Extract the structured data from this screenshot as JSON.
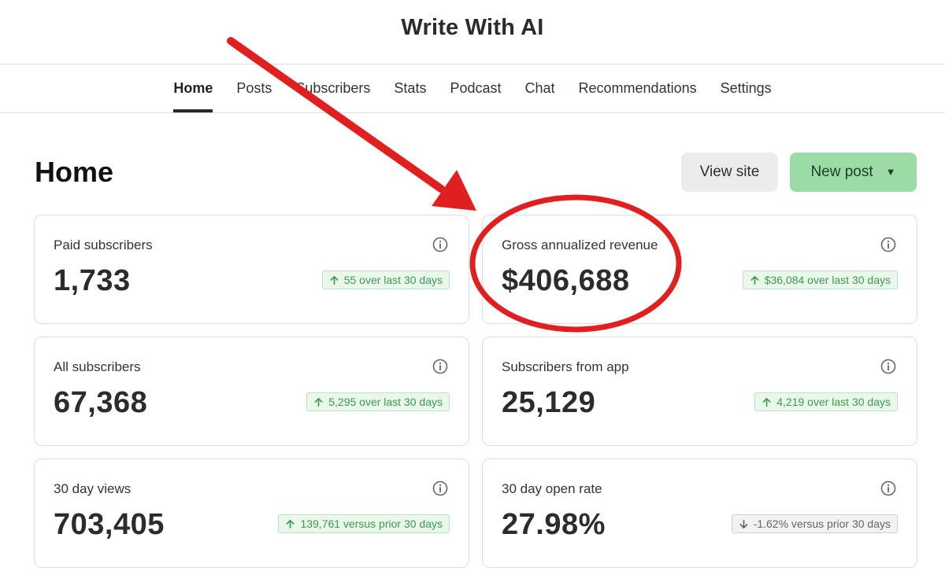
{
  "site": {
    "title": "Write With AI"
  },
  "nav": {
    "tabs": [
      {
        "label": "Home",
        "active": true
      },
      {
        "label": "Posts"
      },
      {
        "label": "Subscribers"
      },
      {
        "label": "Stats"
      },
      {
        "label": "Podcast"
      },
      {
        "label": "Chat"
      },
      {
        "label": "Recommendations"
      },
      {
        "label": "Settings"
      }
    ]
  },
  "page": {
    "title": "Home",
    "view_site_label": "View site",
    "new_post_label": "New post"
  },
  "cards": [
    {
      "label": "Paid subscribers",
      "value": "1,733",
      "trend": "up",
      "change": "55 over last 30 days"
    },
    {
      "label": "Gross annualized revenue",
      "value": "$406,688",
      "trend": "up",
      "change": "$36,084 over last 30 days"
    },
    {
      "label": "All subscribers",
      "value": "67,368",
      "trend": "up",
      "change": "5,295 over last 30 days"
    },
    {
      "label": "Subscribers from app",
      "value": "25,129",
      "trend": "up",
      "change": "4,219 over last 30 days"
    },
    {
      "label": "30 day views",
      "value": "703,405",
      "trend": "up",
      "change": "139,761 versus prior 30 days"
    },
    {
      "label": "30 day open rate",
      "value": "27.98%",
      "trend": "down",
      "change": "-1.62% versus prior 30 days"
    }
  ],
  "colors": {
    "positive": "#3c9a4e",
    "neutral": "#666666",
    "annotation": "#e02020",
    "new_post_button": "#9bdca6"
  }
}
